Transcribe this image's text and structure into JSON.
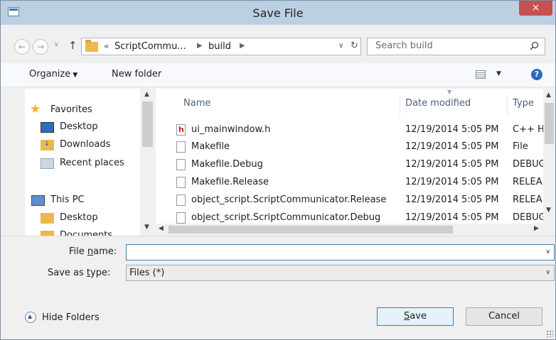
{
  "window": {
    "title": "Save File",
    "close_label": "×"
  },
  "address": {
    "overflow": "«",
    "crumbs": [
      "ScriptCommu...",
      "build"
    ],
    "separator": "▶",
    "dropdown": "∨",
    "refresh": "↻"
  },
  "search": {
    "placeholder": "Search build",
    "icon": "search-icon"
  },
  "nav_buttons": {
    "back": "←",
    "forward": "→",
    "recent": "∨",
    "up": "↑"
  },
  "toolbar": {
    "organize_label": "Organize",
    "organize_caret": "▼",
    "new_folder_label": "New folder",
    "view_caret": "▼",
    "help_label": "?"
  },
  "nav_pane": {
    "items": [
      {
        "label": "Favorites",
        "icon": "star-icon"
      },
      {
        "label": "Desktop",
        "icon": "desktop-icon"
      },
      {
        "label": "Downloads",
        "icon": "downloads-icon"
      },
      {
        "label": "Recent places",
        "icon": "recent-places-icon"
      },
      {
        "label": "This PC",
        "icon": "computer-icon"
      },
      {
        "label": "Desktop",
        "icon": "folder-icon"
      },
      {
        "label": "Documents",
        "icon": "folder-icon"
      }
    ]
  },
  "file_list": {
    "columns": [
      "Name",
      "Date modified",
      "Type"
    ],
    "rows": [
      {
        "name": "ui_mainwindow.h",
        "date": "12/19/2014 5:05 PM",
        "type": "C++ H",
        "icon": "header-file-icon"
      },
      {
        "name": "Makefile",
        "date": "12/19/2014 5:05 PM",
        "type": "File",
        "icon": "file-icon"
      },
      {
        "name": "Makefile.Debug",
        "date": "12/19/2014 5:05 PM",
        "type": "DEBUG",
        "icon": "file-icon"
      },
      {
        "name": "Makefile.Release",
        "date": "12/19/2014 5:05 PM",
        "type": "RELEA",
        "icon": "file-icon"
      },
      {
        "name": "object_script.ScriptCommunicator.Release",
        "date": "12/19/2014 5:05 PM",
        "type": "RELEA",
        "icon": "file-icon"
      },
      {
        "name": "object_script.ScriptCommunicator.Debug",
        "date": "12/19/2014 5:05 PM",
        "type": "DEBUG",
        "icon": "file-icon"
      }
    ]
  },
  "form": {
    "filename_label_pre": "File ",
    "filename_label_u": "n",
    "filename_label_post": "ame:",
    "filename_value": "",
    "savetype_label_pre": "Save as ",
    "savetype_label_u": "t",
    "savetype_label_post": "ype:",
    "savetype_value": "Files (*)",
    "caret": "∨"
  },
  "footer": {
    "hide_folders_label": "Hide Folders",
    "save_label_u": "S",
    "save_label_post": "ave",
    "cancel_label": "Cancel"
  }
}
